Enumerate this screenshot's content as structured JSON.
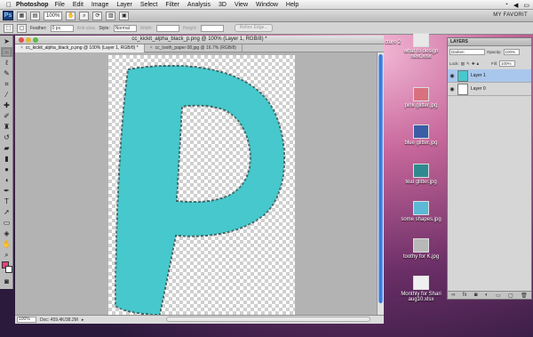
{
  "menubar": {
    "app_name": "Photoshop",
    "items": [
      "File",
      "Edit",
      "Image",
      "Layer",
      "Select",
      "Filter",
      "Analysis",
      "3D",
      "View",
      "Window",
      "Help"
    ]
  },
  "appbar": {
    "logo": "Ps",
    "zoom": "100%",
    "workspace": "MY FAVORIT"
  },
  "options": {
    "feather_label": "Feather:",
    "feather_value": "0 px",
    "antialias_label": "Anti-alias",
    "style_label": "Style:",
    "style_value": "Normal",
    "width_label": "Width:",
    "height_label": "Height:",
    "refine_edge": "Refine Edge..."
  },
  "document": {
    "window_title": "cc_kickit_alpha_black_p.png @ 100% (Layer 1, RGB/8) *",
    "tabs": [
      "cc_kickit_alpha_black_p.png @ 100% (Layer 1, RGB/8) *",
      "cc_tooth_paper 08.jpg @ 16.7% (RGB/8)"
    ],
    "zoom_status": "100%",
    "doc_status": "Doc: 459.4K/38.2M"
  },
  "desktop": {
    "partial_label": "cture 2",
    "icons": [
      {
        "label": "what to design next.xlsx",
        "color": "#e8e8e8"
      },
      {
        "label": "pink glitter.jpg",
        "color": "#d9707e"
      },
      {
        "label": "blue glitter.jpg",
        "color": "#3b5da6"
      },
      {
        "label": "teal glitter.jpg",
        "color": "#2f8a8f"
      },
      {
        "label": "some shapes.jpg",
        "color": "#5bb9d6"
      },
      {
        "label": "toothy for K.jpg",
        "color": "#b8b8b8"
      },
      {
        "label": "Monthly for Shari aug10.xlsx",
        "color": "#efefef"
      }
    ]
  },
  "layers": {
    "title": "LAYERS",
    "blend_mode": "Darken",
    "opacity_label": "Opacity:",
    "opacity_value": "100%",
    "lock_label": "Lock:",
    "fill_label": "Fill:",
    "fill_value": "100%",
    "items": [
      {
        "name": "Layer 1",
        "active": true
      },
      {
        "name": "Layer 0",
        "active": false
      }
    ]
  },
  "colors": {
    "letter_fill": "#46c8cc",
    "foreground": "#e8417a"
  }
}
